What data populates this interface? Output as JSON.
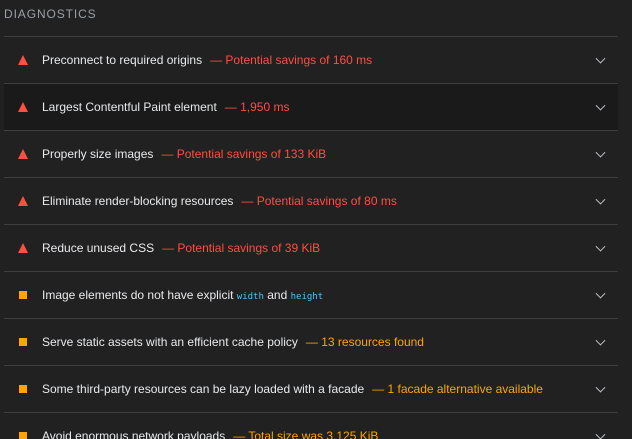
{
  "section": {
    "title": "DIAGNOSTICS"
  },
  "colors": {
    "fail": "#ff4e42",
    "average": "#ffa400",
    "code": "#4fc3f7"
  },
  "audits": [
    {
      "icon": "fail-triangle-icon",
      "title": "Preconnect to required origins",
      "display": "— Potential savings of 160 ms"
    },
    {
      "icon": "fail-triangle-icon",
      "title": "Largest Contentful Paint element",
      "display": "— 1,950 ms"
    },
    {
      "icon": "fail-triangle-icon",
      "title": "Properly size images",
      "display": "— Potential savings of 133 KiB"
    },
    {
      "icon": "fail-triangle-icon",
      "title": "Eliminate render-blocking resources",
      "display": "— Potential savings of 80 ms"
    },
    {
      "icon": "fail-triangle-icon",
      "title": "Reduce unused CSS",
      "display": "— Potential savings of 39 KiB"
    },
    {
      "icon": "average-square-icon",
      "title_part1": "Image elements do not have explicit",
      "code1": "width",
      "title_part2": "and",
      "code2": "height"
    },
    {
      "icon": "average-square-icon",
      "title": "Serve static assets with an efficient cache policy",
      "display": "— 13 resources found"
    },
    {
      "icon": "average-square-icon",
      "title": "Some third-party resources can be lazy loaded with a facade",
      "display": "— 1 facade alternative available"
    },
    {
      "icon": "average-square-icon",
      "title": "Avoid enormous network payloads",
      "display": "— Total size was 3,125 KiB"
    }
  ]
}
